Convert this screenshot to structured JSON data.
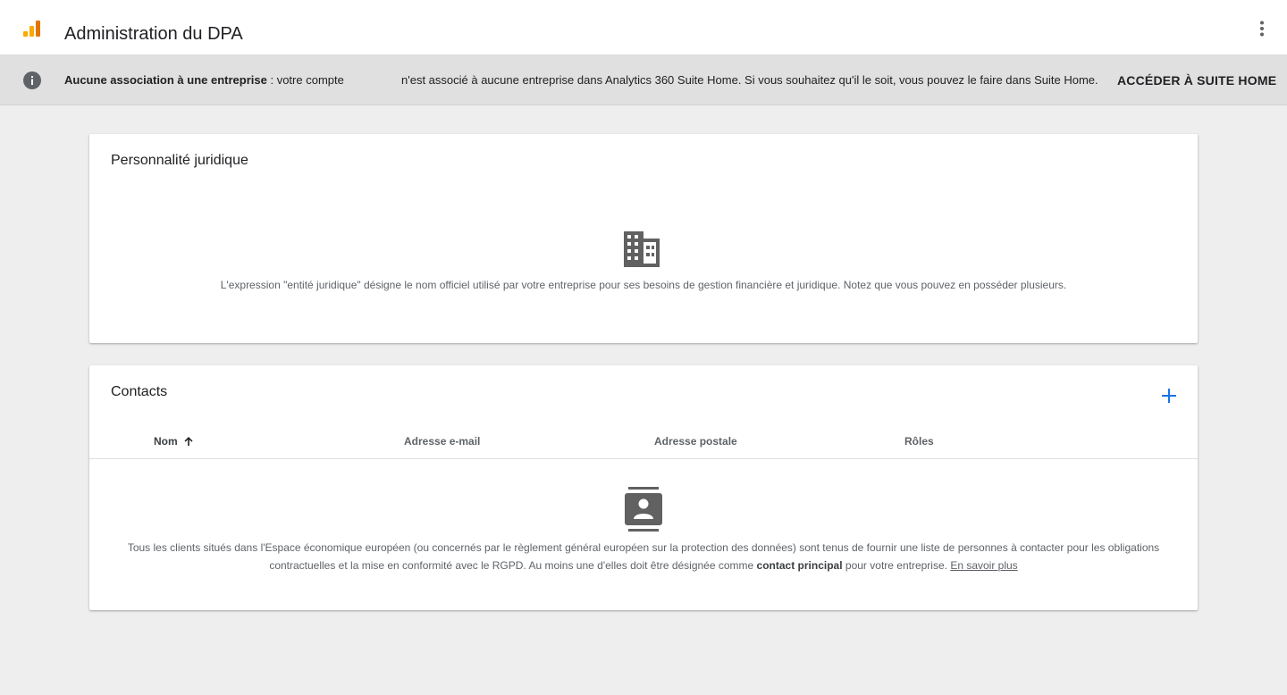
{
  "header": {
    "title": "Administration du DPA",
    "logo_icon": "analytics-logo-icon",
    "menu_icon": "more-vert-icon",
    "logo_colors": [
      "#f9ab00",
      "#e37400"
    ]
  },
  "banner": {
    "icon": "info-icon",
    "bold_text": "Aucune association à une entreprise",
    "text_part1": " : votre compte",
    "text_part2": "n'est associé à aucune entreprise dans Analytics 360 Suite Home. Si vous souhaitez qu'il le soit, vous pouvez le faire dans Suite Home.",
    "action_label": "ACCÉDER À SUITE HOME"
  },
  "legal_entity": {
    "title": "Personnalité juridique",
    "icon": "building-icon",
    "description": "L'expression \"entité juridique\" désigne le nom officiel utilisé par votre entreprise pour ses besoins de gestion financière et juridique. Notez que vous pouvez en posséder plusieurs."
  },
  "contacts": {
    "title": "Contacts",
    "add_icon": "add-icon",
    "accent_color": "#1a73e8",
    "columns": [
      {
        "label": "Nom",
        "sort_icon": "arrow-up-icon"
      },
      {
        "label": "Adresse e-mail"
      },
      {
        "label": "Adresse postale"
      },
      {
        "label": "Rôles"
      }
    ],
    "empty_icon": "contact-card-icon",
    "description_part1": "Tous les clients situés dans l'Espace économique européen (ou concernés par le règlement général européen sur la protection des données) sont tenus de fournir une liste de personnes à contacter pour les obligations contractuelles et la mise en conformité avec le RGPD. Au moins une d'elles doit être désignée comme ",
    "description_bold": "contact principal",
    "description_part2": " pour votre entreprise. ",
    "learn_more": "En savoir plus"
  }
}
